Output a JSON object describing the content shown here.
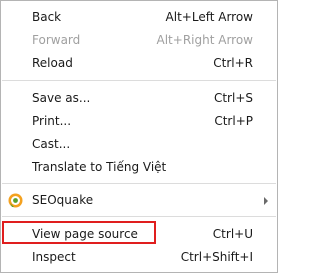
{
  "menu": {
    "back": {
      "label": "Back",
      "shortcut": "Alt+Left Arrow"
    },
    "forward": {
      "label": "Forward",
      "shortcut": "Alt+Right Arrow"
    },
    "reload": {
      "label": "Reload",
      "shortcut": "Ctrl+R"
    },
    "save_as": {
      "label": "Save as...",
      "shortcut": "Ctrl+S"
    },
    "print": {
      "label": "Print...",
      "shortcut": "Ctrl+P"
    },
    "cast": {
      "label": "Cast..."
    },
    "translate": {
      "label": "Translate to Tiếng Việt"
    },
    "seoquake": {
      "label": "SEOquake",
      "icon": "seoquake-icon"
    },
    "view_source": {
      "label": "View page source",
      "shortcut": "Ctrl+U"
    },
    "inspect": {
      "label": "Inspect",
      "shortcut": "Ctrl+Shift+I"
    }
  },
  "colors": {
    "highlight_border": "#e01e1e",
    "text": "#1a1a1a",
    "disabled_text": "#a0a0a0",
    "separator": "#dcdcdc"
  }
}
